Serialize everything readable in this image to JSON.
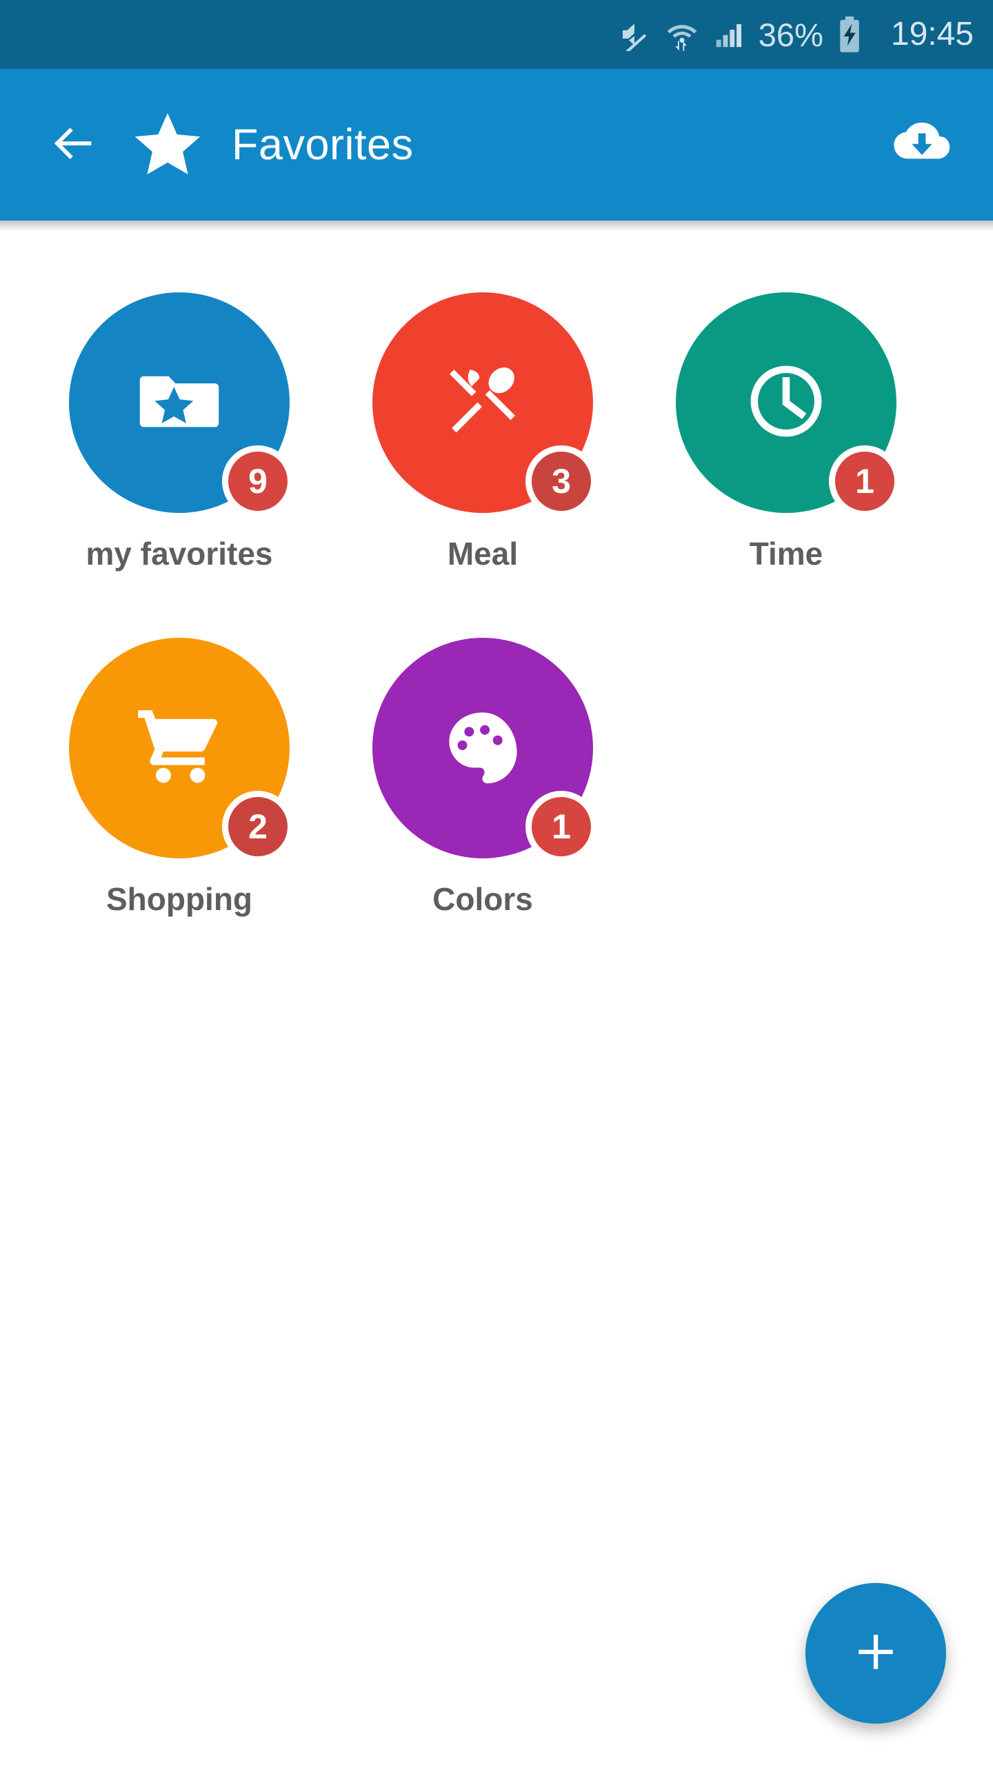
{
  "status_bar": {
    "background": "#0c648c",
    "mute_icon": "mute-icon",
    "wifi_icon": "wifi-data-icon",
    "signal_icon": "cellular-signal-icon",
    "battery_percent": "36%",
    "battery_icon": "battery-charging-icon",
    "clock": "19:45"
  },
  "app_bar": {
    "background": "#1189c9",
    "back_icon": "arrow-left-icon",
    "star_icon": "star-icon",
    "title": "Favorites",
    "download_icon": "cloud-download-icon"
  },
  "grid": {
    "items": [
      {
        "label": "my favorites",
        "icon": "folder-star-icon",
        "badge": "9",
        "color": "#1584c3",
        "badge_color": "#d6453f"
      },
      {
        "label": "Meal",
        "icon": "knife-spoon-icon",
        "badge": "3",
        "color": "#f0412f",
        "badge_color": "#c9443f"
      },
      {
        "label": "Time",
        "icon": "clock-icon",
        "badge": "1",
        "color": "#0a9a84",
        "badge_color": "#d6453f"
      },
      {
        "label": "Shopping",
        "icon": "shopping-cart-icon",
        "badge": "2",
        "color": "#f99806",
        "badge_color": "#c9443f"
      },
      {
        "label": "Colors",
        "icon": "palette-icon",
        "badge": "1",
        "color": "#9a27b5",
        "badge_color": "#d6453f"
      }
    ]
  },
  "fab": {
    "icon": "plus-icon",
    "color": "#1484c2"
  }
}
